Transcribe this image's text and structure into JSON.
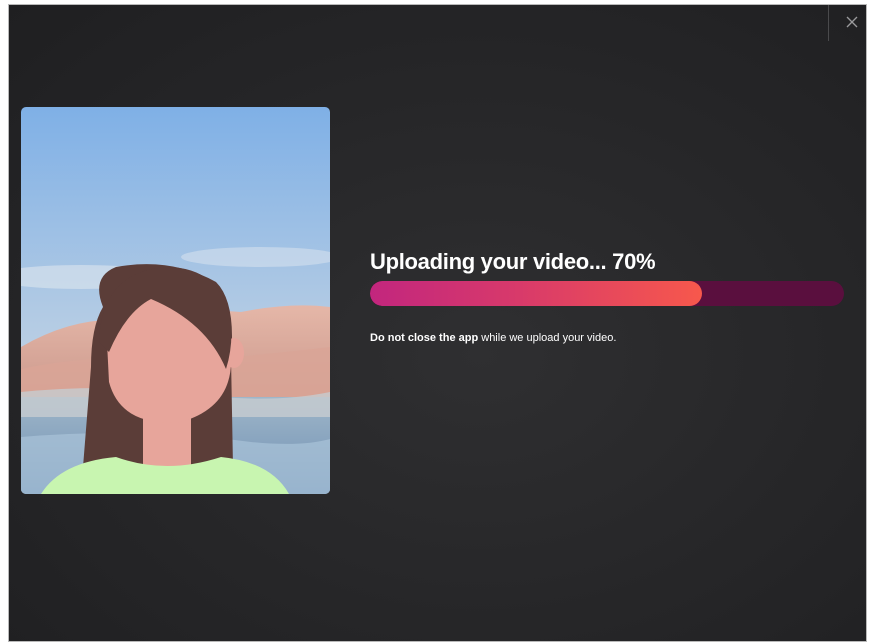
{
  "dialog": {
    "close_label": "×"
  },
  "upload": {
    "title": "Uploading your video... 70%",
    "progress": 0.7,
    "note_strong": "Do not close the app",
    "note_rest": " while we upload your video."
  },
  "colors": {
    "track": "#5a0f3e",
    "fill_start": "#c2267e",
    "fill_end": "#f7584c"
  }
}
